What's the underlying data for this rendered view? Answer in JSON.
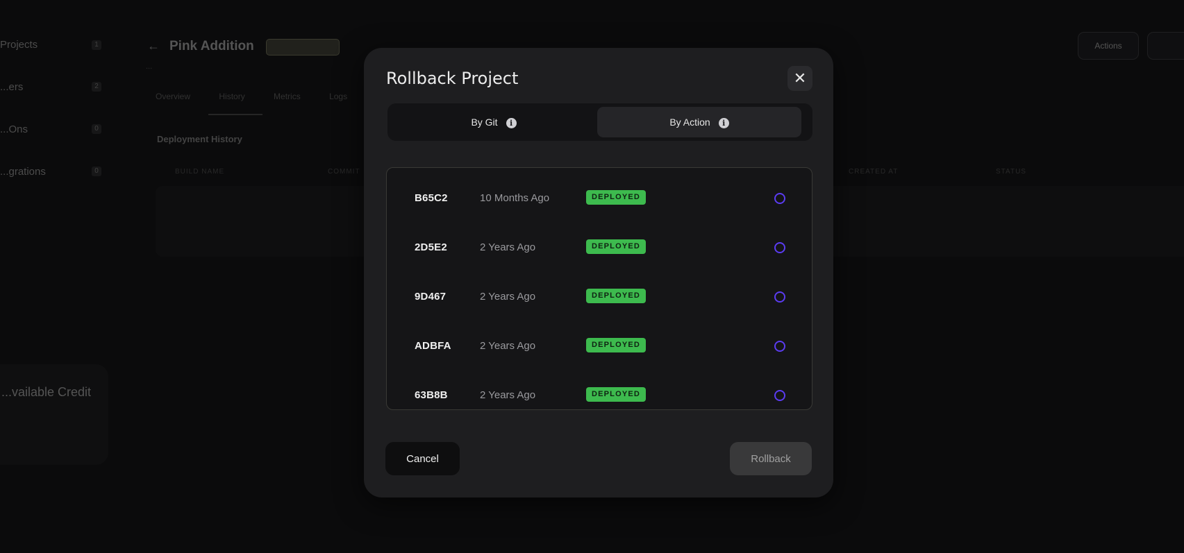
{
  "background": {
    "sidebar": [
      {
        "label": "Projects",
        "count": "1"
      },
      {
        "label": "...ers",
        "count": "2"
      },
      {
        "label": "...Ons",
        "count": "0"
      },
      {
        "label": "...grations",
        "count": "0"
      }
    ],
    "credit_label": "...vailable Credit",
    "page_title": "Pink Addition",
    "breadcrumb": "...",
    "tabs": [
      "Overview",
      "History",
      "Metrics",
      "Logs"
    ],
    "section_title": "Deployment History",
    "table_headers": [
      "BUILD NAME",
      "COMMIT",
      "CREATED AT",
      "STATUS"
    ],
    "actions_label": "Actions"
  },
  "modal": {
    "title": "Rollback Project",
    "tabs": [
      {
        "label": "By Git",
        "info_icon": "info-icon"
      },
      {
        "label": "By Action",
        "info_icon": "info-icon",
        "active": true
      }
    ],
    "items": [
      {
        "id": "B65C2",
        "time": "10 Months Ago",
        "status": "DEPLOYED"
      },
      {
        "id": "2D5E2",
        "time": "2 Years Ago",
        "status": "DEPLOYED"
      },
      {
        "id": "9D467",
        "time": "2 Years Ago",
        "status": "DEPLOYED"
      },
      {
        "id": "ADBFA",
        "time": "2 Years Ago",
        "status": "DEPLOYED"
      },
      {
        "id": "63B8B",
        "time": "2 Years Ago",
        "status": "DEPLOYED"
      }
    ],
    "cancel_label": "Cancel",
    "rollback_label": "Rollback"
  },
  "colors": {
    "accent": "#5b3cf2",
    "deployed": "#3dba4e",
    "modal_bg": "#1e1e20"
  }
}
